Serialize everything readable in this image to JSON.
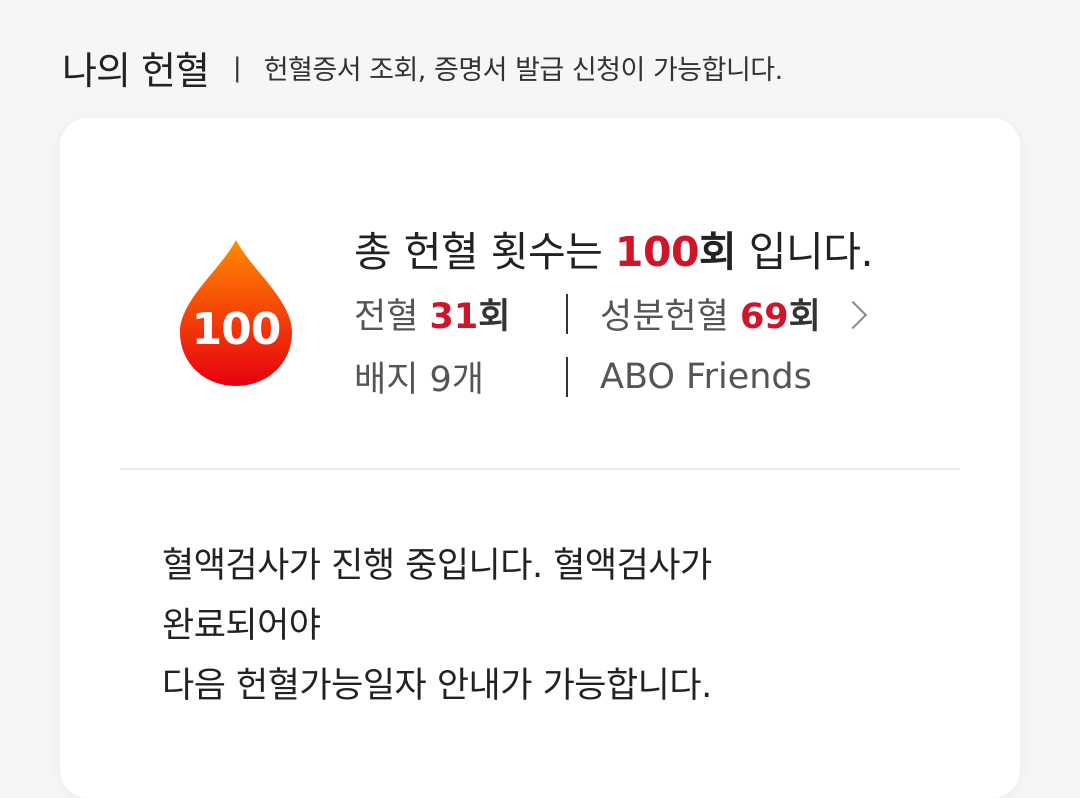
{
  "header": {
    "title": "나의 헌혈",
    "separator": "|",
    "description": "헌혈증서 조회, 증명서 발급 신청이 가능합니다."
  },
  "summary": {
    "badge_count": "100",
    "prefix": "총 헌혈 횟수는 ",
    "count": "100",
    "unit": "회",
    "suffix": " 입니다."
  },
  "stats": {
    "whole_blood_label": "전혈 ",
    "whole_blood_count": "31",
    "whole_blood_unit": "회",
    "component_label": "성분헌혈 ",
    "component_count": "69",
    "component_unit": "회",
    "badge_label": "배지 9개",
    "club_label": "ABO Friends"
  },
  "notice": {
    "line1": "혈액검사가 진행 중입니다. 혈액검사가",
    "line2": "완료되어야",
    "line3": "다음 헌혈가능일자 안내가 가능합니다."
  },
  "colors": {
    "accent": "#d0152a",
    "drop_top": "#ff8a00",
    "drop_bottom": "#e8000f"
  }
}
